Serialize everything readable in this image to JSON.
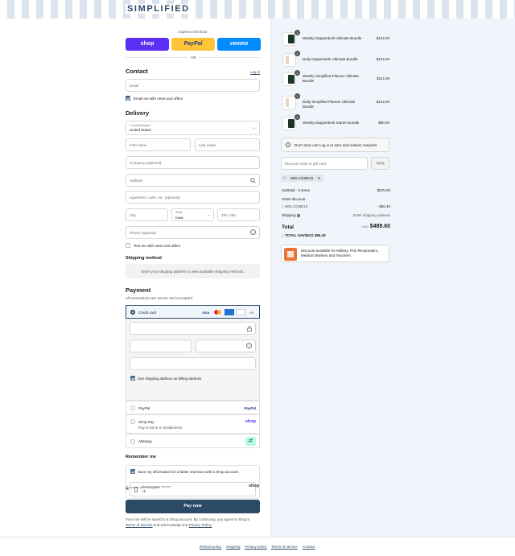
{
  "brand": {
    "logo": "SIMPLIFIED"
  },
  "express": {
    "title": "Express checkout",
    "shop": "shop",
    "paypal": "PayPal",
    "venmo": "venmo",
    "or": "OR"
  },
  "contact": {
    "heading": "Contact",
    "login": "Log in",
    "email_placeholder": "Email",
    "news_label": "Email me with news and offers"
  },
  "delivery": {
    "heading": "Delivery",
    "country_label": "Country/Region",
    "country_value": "United States",
    "first_name": "First name",
    "last_name": "Last name",
    "company": "Company (optional)",
    "address": "Address",
    "apartment": "Apartment, suite, etc. (optional)",
    "city": "City",
    "state_label": "State",
    "state_value": "Iowa",
    "zip": "ZIP code",
    "phone": "Phone (optional)",
    "text_label": "Text me with news and offers"
  },
  "shipping": {
    "heading": "Shipping method",
    "placeholder": "Enter your shipping address to view available shipping methods."
  },
  "payment": {
    "heading": "Payment",
    "subtitle": "All transactions are secure and encrypted.",
    "credit_card": "Credit card",
    "card_more": "+3",
    "billing_label": "Use shipping address as billing address",
    "paypal": "PayPal",
    "paypal_logo": "PayPal",
    "shoppay": "Shop Pay",
    "shoppay_sub": "Pay in full or in installments",
    "shoppay_logo": "shop",
    "afterpay": "Afterpay"
  },
  "remember": {
    "heading": "Remember me",
    "save_label": "Save my information for a faster checkout with a Shop account",
    "mobile_label": "Mobile phone number",
    "mobile_value": "+1",
    "secure": "Secure and encrypted",
    "shop_logo": "shop"
  },
  "paynow": {
    "label": "Pay now"
  },
  "legal": {
    "line1": "Your info will be saved to a Shop account. By continuing, you agree to Shop's",
    "terms": "Terms of Service",
    "and": "and acknowledge the",
    "privacy": "Privacy Policy."
  },
  "footer": {
    "refund": "Refund policy",
    "shipping": "Shipping",
    "privacy": "Privacy policy",
    "terms": "Terms of service",
    "contact": "Contact"
  },
  "cart": {
    "items": [
      {
        "qty": "1",
        "name": "Weekly Dapperdesk Ultimate Bundle",
        "price": "$124.00"
      },
      {
        "qty": "1",
        "name": "Daily Dapperdesk Ultimate Bundle",
        "price": "$124.00"
      },
      {
        "qty": "1",
        "name": "Weekly Simplified Planner Ultimate Bundle",
        "price": "$114.00"
      },
      {
        "qty": "1",
        "name": "Daily Simplified Planner Ultimate Bundle",
        "price": "$124.00"
      },
      {
        "qty": "1",
        "name": "Weekly Dapperdesk Starter Bundle",
        "price": "$90.00"
      }
    ],
    "rewards": "Don't miss out! Log in to earn and redeem rewards!",
    "discount_placeholder": "Discount code or gift card",
    "apply": "Apply",
    "code": "WELCOME15",
    "subtotal_label": "Subtotal · 5 items",
    "subtotal": "$576.00",
    "order_discount": "Order discount",
    "discount_code": "WELCOME15",
    "discount_value": "- $86.40",
    "shipping_label": "Shipping",
    "shipping_value": "Enter shipping address",
    "total_label": "Total",
    "currency": "USD",
    "total": "$489.60",
    "savings_label": "TOTAL SAVINGS",
    "savings": "$86.40",
    "promo": "Discount available for Military, First Responders, Medical Workers and Teachers"
  },
  "colors": {
    "accent": "#2e4a66",
    "shop": "#5a31f4",
    "paypal": "#ffc439",
    "venmo": "#008cff"
  }
}
